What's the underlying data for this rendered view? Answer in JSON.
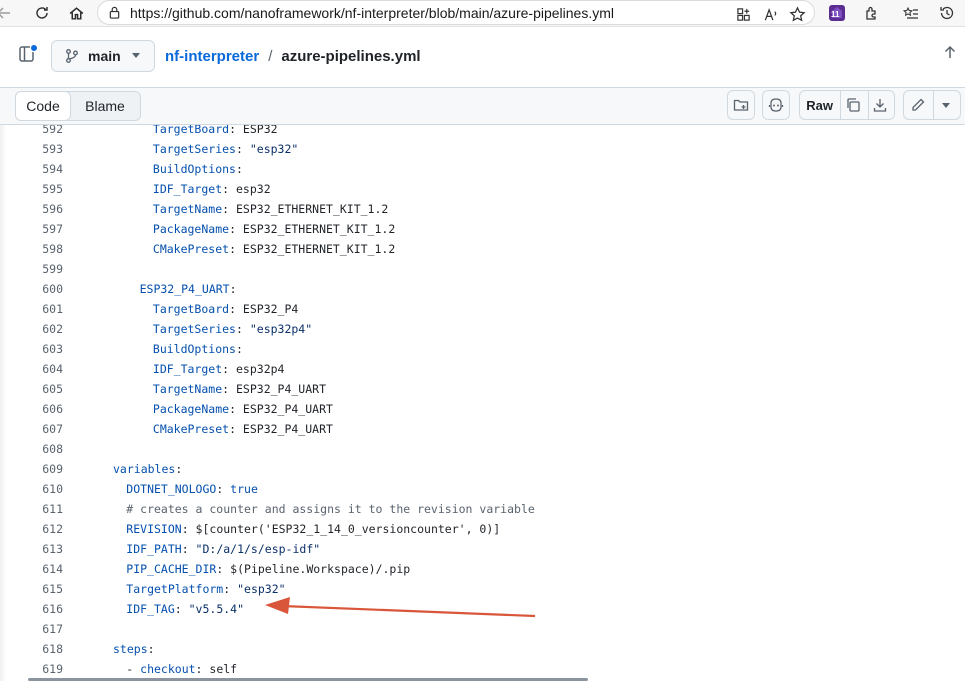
{
  "browser": {
    "url": "https://github.com/nanoframework/nf-interpreter/blob/main/azure-pipelines.yml",
    "profile_badge": "11"
  },
  "header": {
    "branch": "main",
    "repo": "nf-interpreter",
    "separator": "/",
    "file": "azure-pipelines.yml"
  },
  "toolbar": {
    "code_tab": "Code",
    "blame_tab": "Blame",
    "raw_label": "Raw"
  },
  "colors": {
    "key": "#0550ae",
    "string": "#0a3069",
    "comment": "#59636e",
    "link": "#0969da",
    "annotation_arrow": "#d9563a"
  },
  "code_lines": [
    {
      "n": "592",
      "indent": 6,
      "key": "TargetBoard",
      "sep": ": ",
      "val": "ESP32",
      "vtype": "plain"
    },
    {
      "n": "593",
      "indent": 6,
      "key": "TargetSeries",
      "sep": ": ",
      "val": "\"esp32\"",
      "vtype": "str"
    },
    {
      "n": "594",
      "indent": 6,
      "key": "BuildOptions",
      "sep": ":",
      "val": "",
      "vtype": "plain"
    },
    {
      "n": "595",
      "indent": 6,
      "key": "IDF_Target",
      "sep": ": ",
      "val": "esp32",
      "vtype": "plain"
    },
    {
      "n": "596",
      "indent": 6,
      "key": "TargetName",
      "sep": ": ",
      "val": "ESP32_ETHERNET_KIT_1.2",
      "vtype": "plain"
    },
    {
      "n": "597",
      "indent": 6,
      "key": "PackageName",
      "sep": ": ",
      "val": "ESP32_ETHERNET_KIT_1.2",
      "vtype": "plain"
    },
    {
      "n": "598",
      "indent": 6,
      "key": "CMakePreset",
      "sep": ": ",
      "val": "ESP32_ETHERNET_KIT_1.2",
      "vtype": "plain"
    },
    {
      "n": "599",
      "indent": 0,
      "key": "",
      "sep": "",
      "val": "",
      "vtype": "plain"
    },
    {
      "n": "600",
      "indent": 4,
      "key": "ESP32_P4_UART",
      "sep": ":",
      "val": "",
      "vtype": "plain"
    },
    {
      "n": "601",
      "indent": 6,
      "key": "TargetBoard",
      "sep": ": ",
      "val": "ESP32_P4",
      "vtype": "plain"
    },
    {
      "n": "602",
      "indent": 6,
      "key": "TargetSeries",
      "sep": ": ",
      "val": "\"esp32p4\"",
      "vtype": "str"
    },
    {
      "n": "603",
      "indent": 6,
      "key": "BuildOptions",
      "sep": ":",
      "val": "",
      "vtype": "plain"
    },
    {
      "n": "604",
      "indent": 6,
      "key": "IDF_Target",
      "sep": ": ",
      "val": "esp32p4",
      "vtype": "plain"
    },
    {
      "n": "605",
      "indent": 6,
      "key": "TargetName",
      "sep": ": ",
      "val": "ESP32_P4_UART",
      "vtype": "plain"
    },
    {
      "n": "606",
      "indent": 6,
      "key": "PackageName",
      "sep": ": ",
      "val": "ESP32_P4_UART",
      "vtype": "plain"
    },
    {
      "n": "607",
      "indent": 6,
      "key": "CMakePreset",
      "sep": ": ",
      "val": "ESP32_P4_UART",
      "vtype": "plain"
    },
    {
      "n": "608",
      "indent": 0,
      "key": "",
      "sep": "",
      "val": "",
      "vtype": "plain"
    },
    {
      "n": "609",
      "indent": 0,
      "key": "variables",
      "sep": ":",
      "val": "",
      "vtype": "plain"
    },
    {
      "n": "610",
      "indent": 2,
      "key": "DOTNET_NOLOGO",
      "sep": ": ",
      "val": "true",
      "vtype": "key"
    },
    {
      "n": "611",
      "indent": 2,
      "key": "",
      "sep": "",
      "val": "# creates a counter and assigns it to the revision variable",
      "vtype": "com"
    },
    {
      "n": "612",
      "indent": 2,
      "key": "REVISION",
      "sep": ": ",
      "val": "$[counter('ESP32_1_14_0_versioncounter', 0)]",
      "vtype": "plain"
    },
    {
      "n": "613",
      "indent": 2,
      "key": "IDF_PATH",
      "sep": ": ",
      "val": "\"D:/a/1/s/esp-idf\"",
      "vtype": "str"
    },
    {
      "n": "614",
      "indent": 2,
      "key": "PIP_CACHE_DIR",
      "sep": ": ",
      "val": "$(Pipeline.Workspace)/.pip",
      "vtype": "plain"
    },
    {
      "n": "615",
      "indent": 2,
      "key": "TargetPlatform",
      "sep": ": ",
      "val": "\"esp32\"",
      "vtype": "str"
    },
    {
      "n": "616",
      "indent": 2,
      "key": "IDF_TAG",
      "sep": ": ",
      "val": "\"v5.5.4\"",
      "vtype": "str"
    },
    {
      "n": "617",
      "indent": 0,
      "key": "",
      "sep": "",
      "val": "",
      "vtype": "plain"
    },
    {
      "n": "618",
      "indent": 0,
      "key": "steps",
      "sep": ":",
      "val": "",
      "vtype": "plain"
    },
    {
      "n": "619",
      "indent": 2,
      "key": "- checkout",
      "sep": ": ",
      "val": "self",
      "vtype": "plain"
    }
  ]
}
